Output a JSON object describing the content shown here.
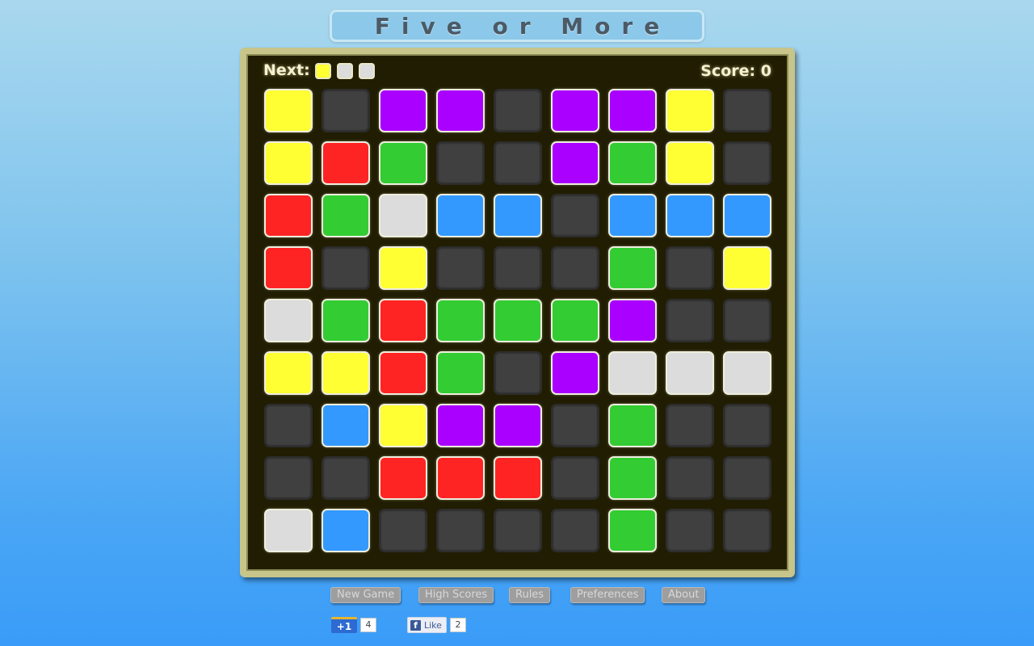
{
  "title": "Five or More",
  "hud": {
    "next_label": "Next:",
    "next_colors": [
      "yellow",
      "white",
      "white"
    ],
    "score_text": "Score: 0",
    "score": 0
  },
  "colors": {
    "yellow": "#ffff33",
    "red": "#ff2424",
    "green": "#33cc33",
    "blue": "#3399ff",
    "purple": "#aa00ff",
    "white": "#dcdcdc",
    "empty": "#404040",
    "board_bg": "#211d02"
  },
  "board": {
    "rows": 9,
    "cols": 9,
    "grid": [
      [
        "yellow",
        null,
        "purple",
        "purple",
        null,
        "purple",
        "purple",
        "yellow",
        null
      ],
      [
        "yellow",
        "red",
        "green",
        null,
        null,
        "purple",
        "green",
        "yellow",
        null
      ],
      [
        "red",
        "green",
        "white",
        "blue",
        "blue",
        null,
        "blue",
        "blue",
        "blue"
      ],
      [
        "red",
        null,
        "yellow",
        null,
        null,
        null,
        "green",
        null,
        "yellow"
      ],
      [
        "white",
        "green",
        "red",
        "green",
        "green",
        "green",
        "purple",
        null,
        null
      ],
      [
        "yellow",
        "yellow",
        "red",
        "green",
        null,
        "purple",
        "white",
        "white",
        "white"
      ],
      [
        null,
        "blue",
        "yellow",
        "purple",
        "purple",
        null,
        "green",
        null,
        null
      ],
      [
        null,
        null,
        "red",
        "red",
        "red",
        null,
        "green",
        null,
        null
      ],
      [
        "white",
        "blue",
        null,
        null,
        null,
        null,
        "green",
        null,
        null
      ]
    ]
  },
  "menu": {
    "new_game": "New Game",
    "high_scores": "High Scores",
    "rules": "Rules",
    "preferences": "Preferences",
    "about": "About"
  },
  "social": {
    "gplus_label": "+1",
    "gplus_count": "4",
    "fb_icon": "f",
    "fb_label": "Like",
    "fb_count": "2"
  }
}
